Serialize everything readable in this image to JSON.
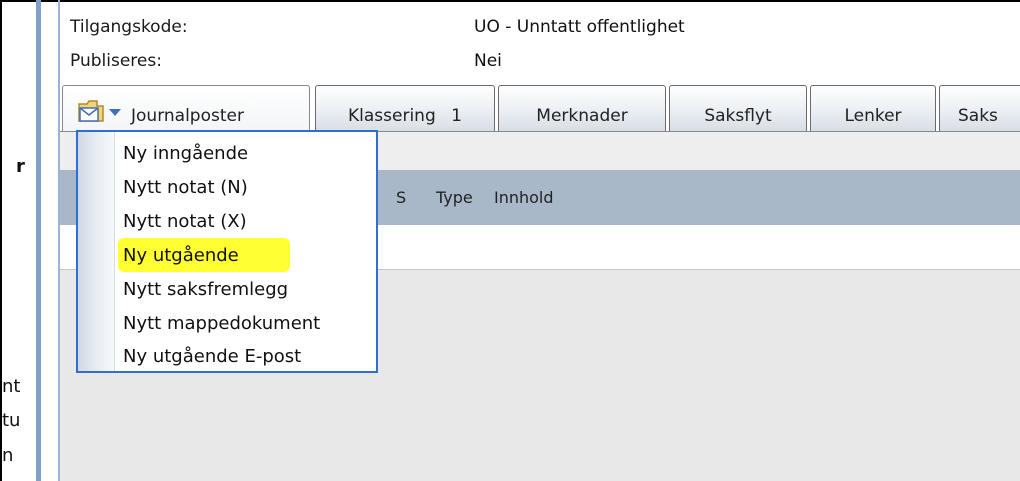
{
  "left_fragments": {
    "r": "r",
    "nt": "nt",
    "tu": "tu",
    "n": "n"
  },
  "info": {
    "tilgangskode_label": "Tilgangskode:",
    "tilgangskode_value": "UO - Unntatt offentlighet",
    "publiseres_label": "Publiseres:",
    "publiseres_value": "Nei"
  },
  "tabs": [
    {
      "label": "Journalposter"
    },
    {
      "label": "Klassering",
      "count": "1"
    },
    {
      "label": "Merknader"
    },
    {
      "label": "Saksflyt"
    },
    {
      "label": "Lenker"
    },
    {
      "label": "Saks"
    }
  ],
  "grid": {
    "col_s": "S",
    "col_type": "Type",
    "col_innhold": "Innhold"
  },
  "menu": {
    "items": [
      "Ny inngående",
      "Nytt notat (N)",
      "Nytt notat (X)",
      "Ny utgående",
      "Nytt saksfremlegg",
      "Nytt mappedokument",
      "Ny utgående E-post"
    ],
    "highlighted_index": 3
  },
  "colors": {
    "menu_border": "#2f6fd1",
    "highlight": "#ffff33",
    "grid_header": "#a8b8c8",
    "accent": "#7fa0c8"
  },
  "icons": {
    "tab_icon": "folder-mail-icon",
    "tab_dropdown": "chevron-down-icon"
  }
}
